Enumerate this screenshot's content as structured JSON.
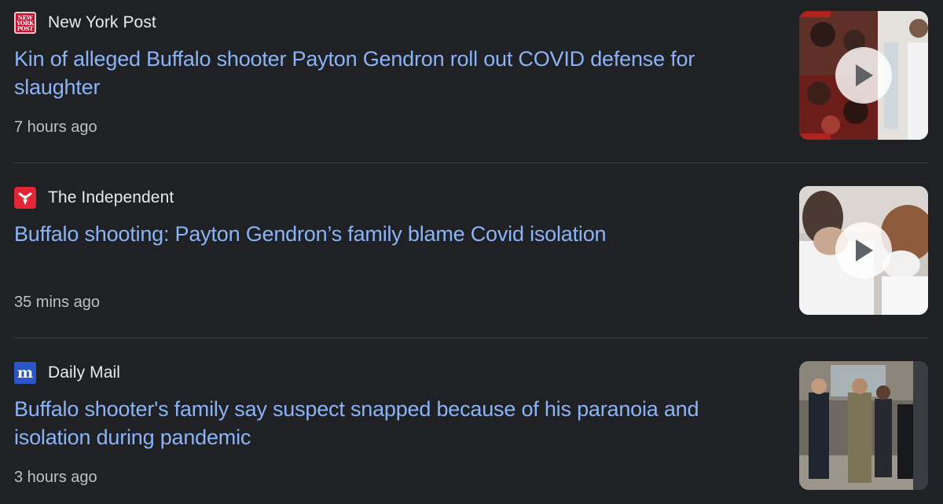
{
  "articles": [
    {
      "source": "New York Post",
      "logo_text": "NEW YORK POST",
      "headline": "Kin of alleged Buffalo shooter Payton Gendron roll out COVID defense for slaughter",
      "time": "7 hours ago",
      "thumbnail_icon": "play-icon"
    },
    {
      "source": "The Independent",
      "logo_icon": "eagle-icon",
      "headline": "Buffalo shooting: Payton Gendron’s family blame Covid isolation",
      "time": "35 mins ago",
      "thumbnail_icon": "play-icon"
    },
    {
      "source": "Daily Mail",
      "logo_text": "m",
      "headline": "Buffalo shooter's family say suspect snapped because of his paranoia and isolation during pandemic",
      "time": "3 hours ago"
    }
  ],
  "colors": {
    "background": "#202124",
    "headline": "#8ab4f8",
    "source": "#e8eaed",
    "timestamp": "#bdc1c6",
    "divider": "#3c4043"
  }
}
